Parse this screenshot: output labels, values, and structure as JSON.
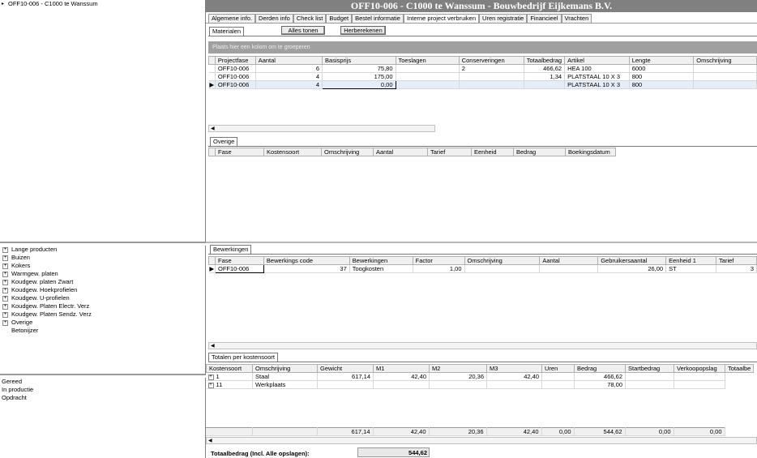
{
  "window_title": "OFF10-006 - C1000 te Wanssum - Bouwbedrijf Eijkemans B.V.",
  "project_tree": {
    "item": "OFF10-006 - C1000 te Wanssum"
  },
  "categories": [
    {
      "label": "Lange producten",
      "expandable": true
    },
    {
      "label": "Buizen",
      "expandable": true
    },
    {
      "label": "Kokers",
      "expandable": true
    },
    {
      "label": "Warmgew. platen",
      "expandable": true
    },
    {
      "label": "Koudgew. platen Zwart",
      "expandable": true
    },
    {
      "label": "Koudgew. Hoekprofielen",
      "expandable": true
    },
    {
      "label": "Koudgew. U-profielen",
      "expandable": true
    },
    {
      "label": "Koudgew. Platen Electr. Verz",
      "expandable": true
    },
    {
      "label": "Koudgew. Platen Sendz. Verz",
      "expandable": true
    },
    {
      "label": "Overige",
      "expandable": true
    },
    {
      "label": "Betonijzer",
      "expandable": false
    }
  ],
  "status_list": [
    "Gereed",
    "In productie",
    "Opdracht"
  ],
  "tabs": [
    "Algemene info.",
    "Derden info",
    "Check list",
    "Budget",
    "Bestel informatie",
    "Interne project verbruiken",
    "Uren registratie",
    "Financieel",
    "Vrachten"
  ],
  "active_tab_index": 5,
  "materialen": {
    "tab_label": "Materialen",
    "btn_show_all": "Alles tonen",
    "btn_recalc": "Herberekenen",
    "group_hint": "Plaats hier een kolom om te groeperen",
    "columns": [
      "Projectfase",
      "Aantal",
      "Basisprijs",
      "Toeslagen",
      "Conserveringen",
      "Totaalbedrag",
      "Artikel",
      "Lengte",
      "Omschrijving"
    ],
    "rows": [
      [
        "OFF10-006",
        "6",
        "75,80",
        "",
        "2",
        "466,62",
        "HEA  100",
        "6000",
        ""
      ],
      [
        "OFF10-006",
        "4",
        "175,00",
        "",
        "",
        "1,34",
        "PLATSTAAL 10 X 3",
        "800",
        ""
      ],
      [
        "OFF10-006",
        "4",
        "0,00",
        "",
        "",
        "",
        "PLATSTAAL 10 X 3",
        "800",
        ""
      ]
    ]
  },
  "overige": {
    "tab_label": "Overige",
    "columns": [
      "Fase",
      "Kostensoort",
      "Omschrijving",
      "Aantal",
      "Tarief",
      "Eenheid",
      "Bedrag",
      "Boekingsdatum"
    ]
  },
  "bewerkingen": {
    "tab_label": "Bewerkingen",
    "columns": [
      "Fase",
      "Bewerkings code",
      "Bewerkingen",
      "Factor",
      "Omschrijving",
      "Aantal",
      "Gebruikersaantal",
      "Eenheid 1",
      "Tarief"
    ],
    "rows": [
      [
        "OFF10-006",
        "37",
        "Toogkosten",
        "1,00",
        "",
        "",
        "26,00",
        "ST",
        "3"
      ]
    ]
  },
  "totalen": {
    "tab_label": "Totalen per kostensoort",
    "columns": [
      "Kostensoort",
      "Omschrijving",
      "Gewicht",
      "M1",
      "M2",
      "M3",
      "Uren",
      "Bedrag",
      "Startbedrag",
      "Verkoopopslag",
      "Totaalbe"
    ],
    "rows": [
      [
        "1",
        "Staal",
        "617,14",
        "42,40",
        "20,36",
        "42,40",
        "",
        "466,62",
        "",
        ""
      ],
      [
        "11",
        "Werkplaats",
        "",
        "",
        "",
        "",
        "",
        "78,00",
        "",
        ""
      ]
    ],
    "footer": [
      "",
      "",
      "617,14",
      "42,40",
      "20,36",
      "42,40",
      "0,00",
      "544,62",
      "0,00",
      "0,00"
    ]
  },
  "grand_total": {
    "label": "Totaalbedrag (Incl. Alle opslagen):",
    "value": "544,62"
  }
}
